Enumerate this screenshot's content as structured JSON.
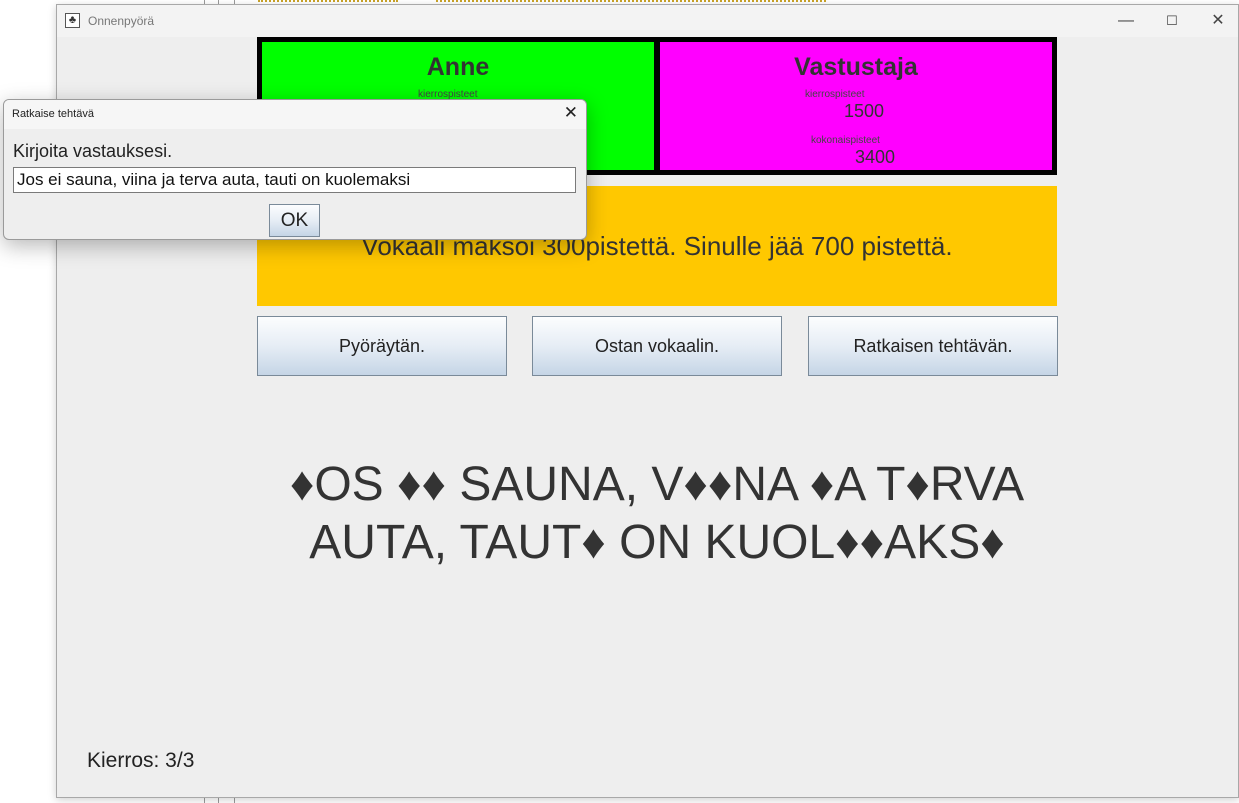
{
  "window": {
    "title": "Onnenpyörä",
    "controls": {
      "minimize": "—",
      "maximize": "☐",
      "close": "✕"
    }
  },
  "players": [
    {
      "name": "Anne",
      "round_points_label": "kierrospisteet",
      "color": "#00ff00"
    },
    {
      "name": "Vastustaja",
      "round_points_label": "kierrospisteet",
      "round_points": "1500",
      "total_points_label": "kokonaispisteet",
      "total_points": "3400",
      "color": "#ff00ff"
    }
  ],
  "message": "Vokaali maksoi 300pistettä. Sinulle jää 700 pistettä.",
  "message_color": "#ffc800",
  "actions": {
    "spin": "Pyöräytän.",
    "buy_vowel": "Ostan vokaalin.",
    "solve": "Ratkaisen tehtävän."
  },
  "puzzle": {
    "line1": "♦OS ♦♦ SAUNA, V♦♦NA ♦A T♦RVA",
    "line2": "AUTA, TAUT♦ ON KUOL♦♦AKS♦"
  },
  "round": "Kierros: 3/3",
  "dialog": {
    "title": "Ratkaise tehtävä",
    "close": "✕",
    "prompt": "Kirjoita vastauksesi.",
    "answer": "Jos ei sauna, viina ja terva auta, tauti on kuolemaksi",
    "ok": "OK"
  }
}
